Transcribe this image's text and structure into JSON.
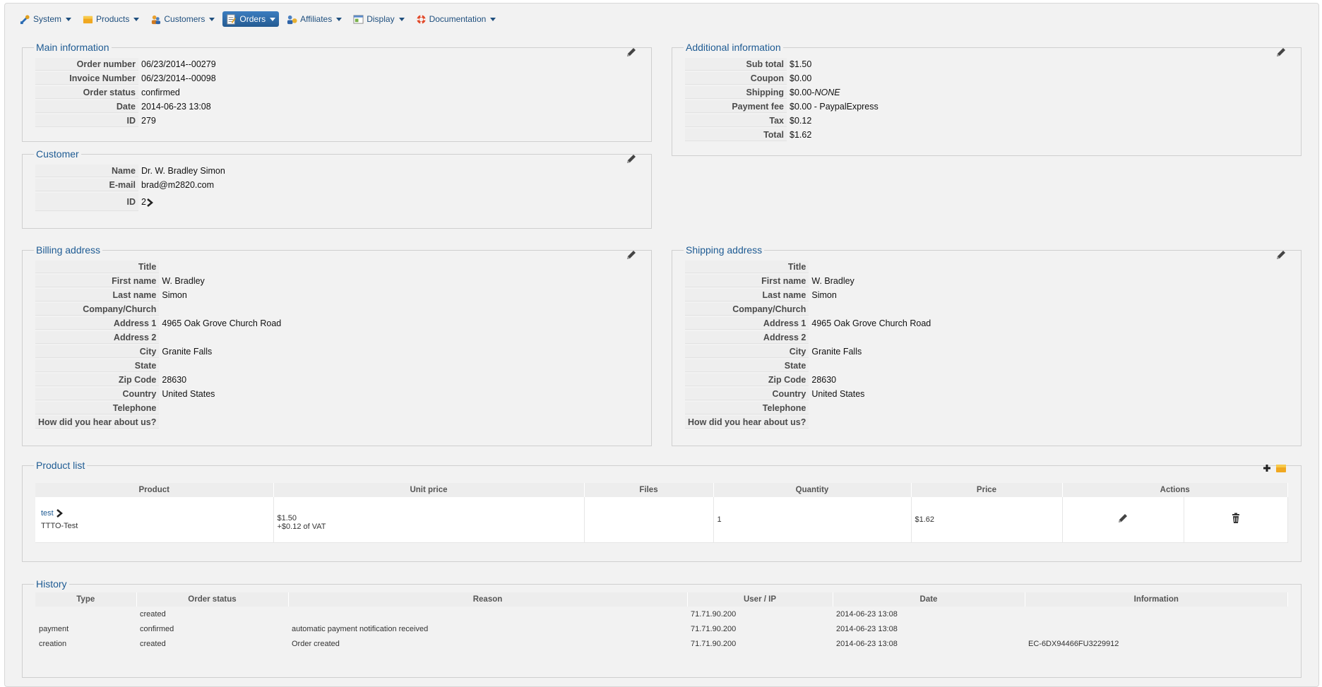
{
  "menu": [
    {
      "label": "System",
      "icon": "tools-icon",
      "active": false
    },
    {
      "label": "Products",
      "icon": "box-icon",
      "active": false
    },
    {
      "label": "Customers",
      "icon": "users-icon",
      "active": false
    },
    {
      "label": "Orders",
      "icon": "order-icon",
      "active": true
    },
    {
      "label": "Affiliates",
      "icon": "affiliate-icon",
      "active": false
    },
    {
      "label": "Display",
      "icon": "display-icon",
      "active": false
    },
    {
      "label": "Documentation",
      "icon": "lifebuoy-icon",
      "active": false
    }
  ],
  "main_info": {
    "title": "Main information",
    "rows": [
      {
        "key": "Order number",
        "value": "06/23/2014--00279"
      },
      {
        "key": "Invoice Number",
        "value": "06/23/2014--00098"
      },
      {
        "key": "Order status",
        "value": "confirmed"
      },
      {
        "key": "Date",
        "value": "2014-06-23 13:08"
      },
      {
        "key": "ID",
        "value": "279"
      }
    ]
  },
  "additional_info": {
    "title": "Additional information",
    "rows": [
      {
        "key": "Sub total",
        "value": "$1.50"
      },
      {
        "key": "Coupon",
        "value": "$0.00"
      },
      {
        "key": "Shipping",
        "value": "$0.00-",
        "value_italic": "NONE"
      },
      {
        "key": "Payment fee",
        "value": "$0.00 - PaypalExpress"
      },
      {
        "key": "Tax",
        "value": "$0.12"
      },
      {
        "key": "Total",
        "value": "$1.62"
      }
    ]
  },
  "customer": {
    "title": "Customer",
    "rows": [
      {
        "key": "Name",
        "value": "Dr. W. Bradley Simon"
      },
      {
        "key": "E-mail",
        "value": "brad@m2820.com"
      },
      {
        "key": "ID",
        "value": "2"
      }
    ]
  },
  "billing": {
    "title": "Billing address",
    "rows": [
      {
        "key": "Title",
        "value": ""
      },
      {
        "key": "First name",
        "value": "W. Bradley"
      },
      {
        "key": "Last name",
        "value": "Simon"
      },
      {
        "key": "Company/Church",
        "value": ""
      },
      {
        "key": "Address 1",
        "value": "4965 Oak Grove Church Road"
      },
      {
        "key": "Address 2",
        "value": ""
      },
      {
        "key": "City",
        "value": "Granite Falls"
      },
      {
        "key": "State",
        "value": ""
      },
      {
        "key": "Zip Code",
        "value": "28630"
      },
      {
        "key": "Country",
        "value": "United States"
      },
      {
        "key": "Telephone",
        "value": ""
      },
      {
        "key": "How did you hear about us?",
        "value": ""
      }
    ]
  },
  "shipping": {
    "title": "Shipping address",
    "rows": [
      {
        "key": "Title",
        "value": ""
      },
      {
        "key": "First name",
        "value": "W. Bradley"
      },
      {
        "key": "Last name",
        "value": "Simon"
      },
      {
        "key": "Company/Church",
        "value": ""
      },
      {
        "key": "Address 1",
        "value": "4965 Oak Grove Church Road"
      },
      {
        "key": "Address 2",
        "value": ""
      },
      {
        "key": "City",
        "value": "Granite Falls"
      },
      {
        "key": "State",
        "value": ""
      },
      {
        "key": "Zip Code",
        "value": "28630"
      },
      {
        "key": "Country",
        "value": "United States"
      },
      {
        "key": "Telephone",
        "value": ""
      },
      {
        "key": "How did you hear about us?",
        "value": ""
      }
    ]
  },
  "product_list": {
    "title": "Product list",
    "headers": [
      "Product",
      "Unit price",
      "Files",
      "Quantity",
      "Price",
      "Actions"
    ],
    "row": {
      "product_name": "test",
      "product_code": "TTTO-Test",
      "unit_price": "$1.50",
      "vat": "+$0.12 of VAT",
      "files": "",
      "quantity": "1",
      "price": "$1.62"
    }
  },
  "history": {
    "title": "History",
    "headers": [
      "Type",
      "Order status",
      "Reason",
      "User / IP",
      "Date",
      "Information"
    ],
    "rows": [
      [
        "",
        "created",
        "",
        "71.71.90.200",
        "2014-06-23 13:08",
        ""
      ],
      [
        "payment",
        "confirmed",
        "automatic payment notification received",
        "71.71.90.200",
        "2014-06-23 13:08",
        ""
      ],
      [
        "creation",
        "created",
        "Order created",
        "71.71.90.200",
        "2014-06-23 13:08",
        "EC-6DX94466FU3229912"
      ]
    ]
  },
  "colors": {
    "accent": "#1e5b93",
    "active_menu": "#2f6aa6",
    "page_bg": "#f2f2f2"
  }
}
